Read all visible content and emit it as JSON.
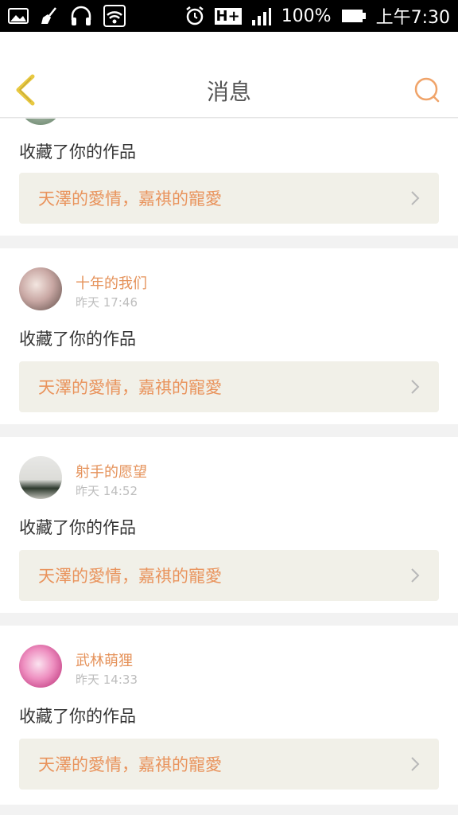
{
  "status_bar": {
    "battery": "100%",
    "time": "上午7:30",
    "network": "H+"
  },
  "header": {
    "title": "消息"
  },
  "messages": [
    {
      "action": "收藏了你的作品",
      "work_title": "天澤的愛情，嘉祺的寵愛"
    },
    {
      "username": "十年的我们",
      "time": "昨天 17:46",
      "action": "收藏了你的作品",
      "work_title": "天澤的愛情，嘉祺的寵愛"
    },
    {
      "username": "射手的愿望",
      "time": "昨天 14:52",
      "action": "收藏了你的作品",
      "work_title": "天澤的愛情，嘉祺的寵愛"
    },
    {
      "username": "武林萌狸",
      "time": "昨天 14:33",
      "action": "收藏了你的作品",
      "work_title": "天澤的愛情，嘉祺的寵愛"
    }
  ],
  "colors": {
    "accent": "#e9935c",
    "back_arrow": "#e8c840",
    "card_bg": "#f1f0e8"
  }
}
